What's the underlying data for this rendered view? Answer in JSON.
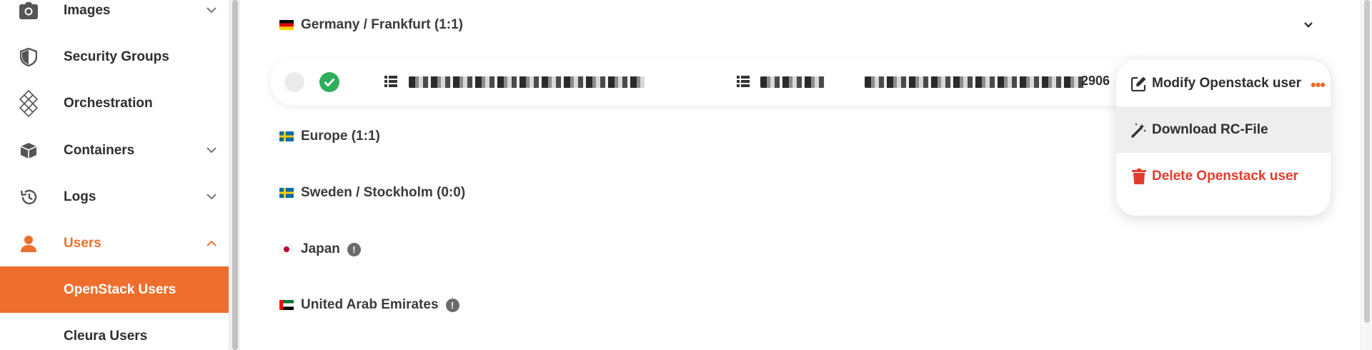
{
  "sidebar": {
    "items": [
      {
        "label": "Images",
        "icon": "camera-icon",
        "has_chevron": true
      },
      {
        "label": "Security Groups",
        "icon": "shield-icon",
        "has_chevron": false
      },
      {
        "label": "Orchestration",
        "icon": "orchestration-icon",
        "has_chevron": false
      },
      {
        "label": "Containers",
        "icon": "box-icon",
        "has_chevron": true
      },
      {
        "label": "Logs",
        "icon": "history-icon",
        "has_chevron": true
      },
      {
        "label": "Users",
        "icon": "user-icon",
        "has_chevron": true,
        "active": true
      }
    ],
    "sub_items": [
      {
        "label": "OpenStack Users",
        "selected": true
      },
      {
        "label": "Cleura Users",
        "selected": false
      }
    ]
  },
  "regions": [
    {
      "flag": "de",
      "name": "Germany / Frankfurt (1:1)",
      "expanded": true,
      "warning": false
    },
    {
      "flag": "se",
      "name": "Europe (1:1)",
      "warning": false
    },
    {
      "flag": "se",
      "name": "Sweden / Stockholm (0:0)",
      "warning": false
    },
    {
      "flag": "jp",
      "name": "Japan",
      "warning": true
    },
    {
      "flag": "ae",
      "name": "United Arab Emirates",
      "warning": true
    }
  ],
  "user_row": {
    "status": "active",
    "visible_suffix": "2906"
  },
  "context_menu": {
    "items": [
      {
        "label": "Modify Openstack user",
        "icon": "edit-icon"
      },
      {
        "label": "Download RC-File",
        "icon": "magic-wand-icon"
      },
      {
        "label": "Delete Openstack user",
        "icon": "trash-icon"
      }
    ],
    "more_glyph": "•••"
  },
  "colors": {
    "accent": "#ee6f2d",
    "success": "#2fae5c",
    "danger": "#e23b2e"
  }
}
